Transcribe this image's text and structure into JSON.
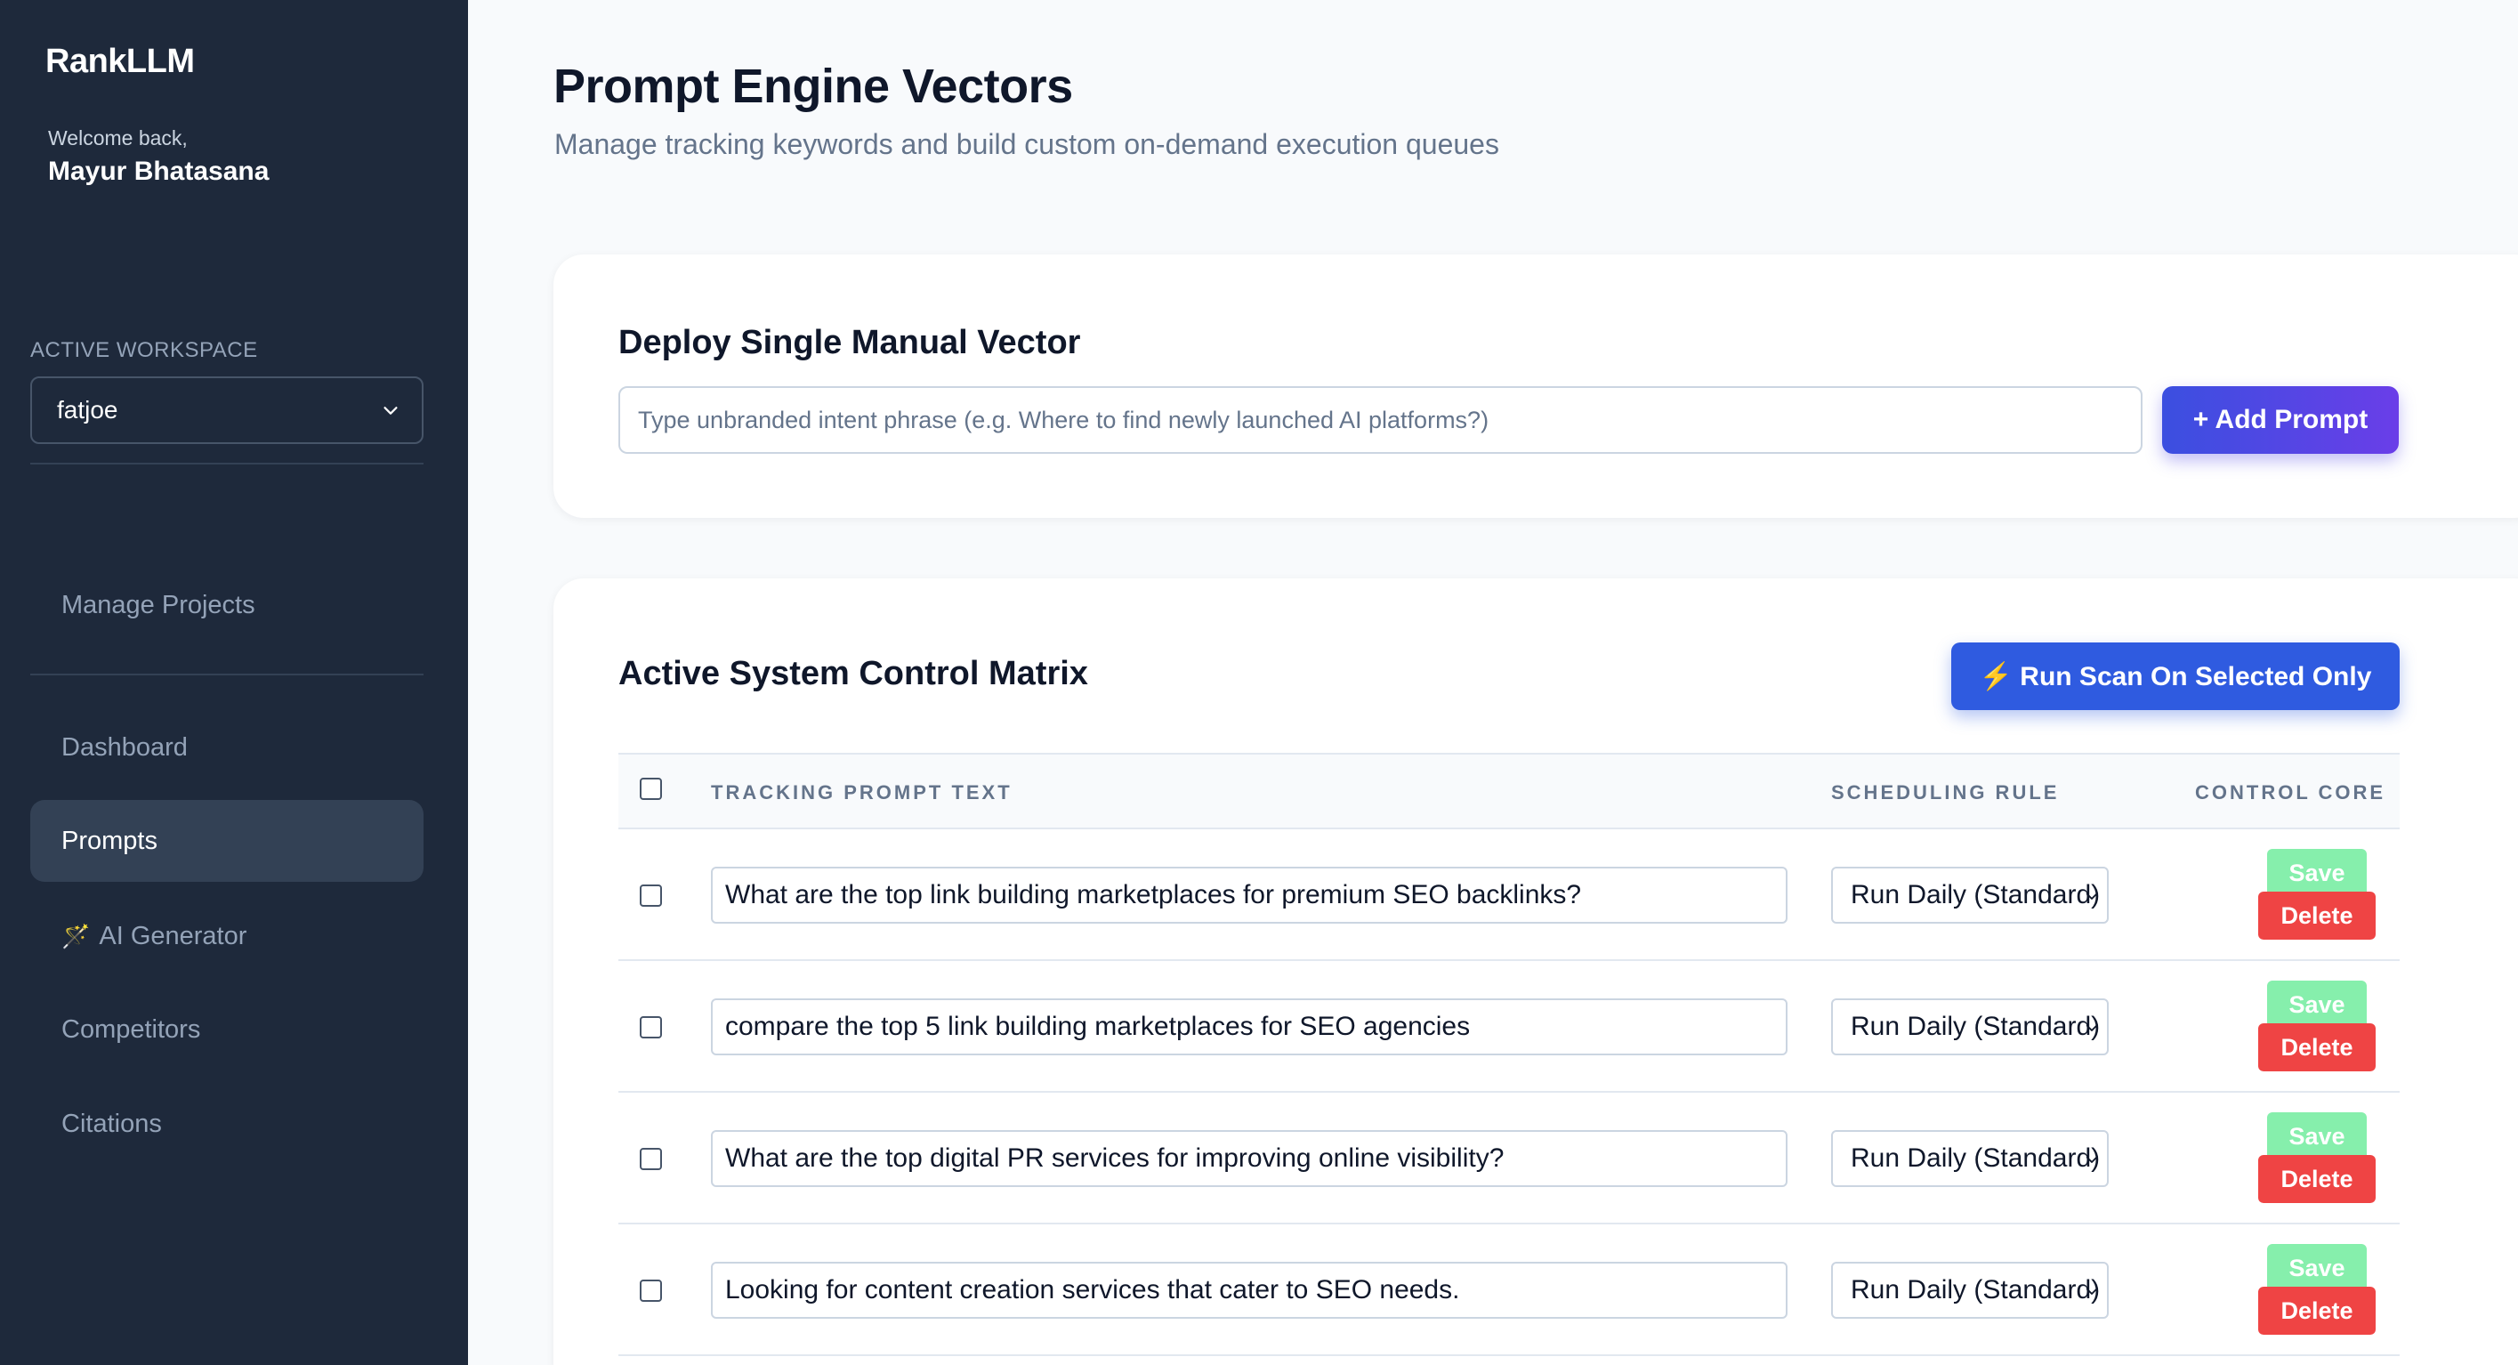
{
  "sidebar": {
    "brand": "RankLLM",
    "welcome": "Welcome back,",
    "user_name": "Mayur Bhatasana",
    "workspace_label": "ACTIVE WORKSPACE",
    "workspace_value": "fatjoe",
    "manage_projects": "Manage Projects",
    "nav": [
      {
        "label": "Dashboard",
        "icon": ""
      },
      {
        "label": "Prompts",
        "icon": "",
        "active": true
      },
      {
        "label": "AI Generator",
        "icon": "🪄"
      },
      {
        "label": "Competitors",
        "icon": ""
      },
      {
        "label": "Citations",
        "icon": ""
      }
    ]
  },
  "header": {
    "title": "Prompt Engine Vectors",
    "subtitle": "Manage tracking keywords and build custom on-demand execution queues"
  },
  "deploy": {
    "title": "Deploy Single Manual Vector",
    "placeholder": "Type unbranded intent phrase (e.g. Where to find newly launched AI platforms?)",
    "add_label": "+ Add Prompt"
  },
  "matrix": {
    "title": "Active System Control Matrix",
    "run_label": "⚡ Run Scan On Selected Only",
    "columns": {
      "prompt": "TRACKING PROMPT TEXT",
      "schedule": "SCHEDULING RULE",
      "control": "CONTROL CORE"
    },
    "rows": [
      {
        "text": "What are the top link building marketplaces for premium SEO backlinks?",
        "schedule": "Run Daily (Standard)"
      },
      {
        "text": "compare the top 5 link building marketplaces for SEO agencies",
        "schedule": "Run Daily (Standard)"
      },
      {
        "text": "What are the top digital PR services for improving online visibility?",
        "schedule": "Run Daily (Standard)"
      },
      {
        "text": "Looking for content creation services that cater to SEO needs.",
        "schedule": "Run Daily (Standard)"
      }
    ],
    "save_label": "Save",
    "delete_label": "Delete"
  },
  "colors": {
    "sidebar_bg": "#1e293b",
    "active_nav_bg": "#334155",
    "primary": "#2f5be0",
    "save": "#86efac",
    "delete": "#ef4444"
  }
}
